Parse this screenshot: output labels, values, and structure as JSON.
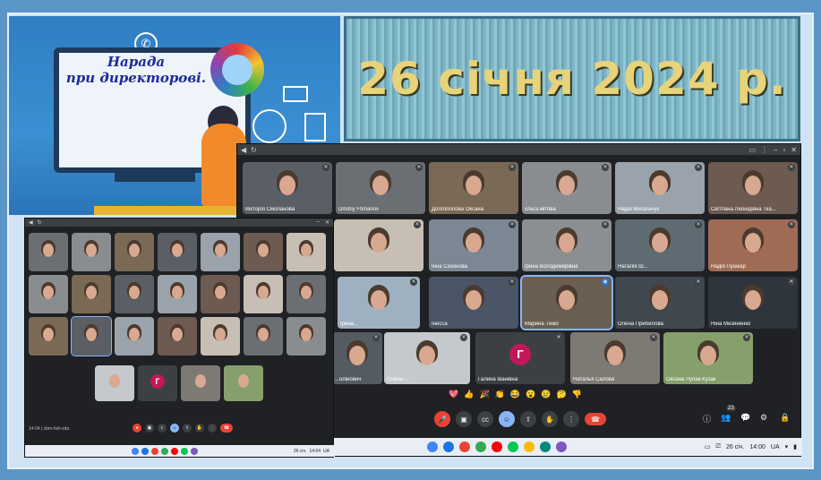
{
  "poster": {
    "title_line1": "Нарада",
    "title_line2": "при директорові.",
    "icons": [
      "phone-icon",
      "globe-icon",
      "mail-icon",
      "document-icon",
      "logo-emblem"
    ]
  },
  "date_banner": "26 січня 2024 р.",
  "meet_large": {
    "participants": [
      {
        "name": "Вікторія Смоланова"
      },
      {
        "name": "Dmitriy Ftimanov"
      },
      {
        "name": "Долгополова Оксана"
      },
      {
        "name": "ольга мітова"
      },
      {
        "name": "Надія Мигальчук"
      },
      {
        "name": "Світлана Леонідівна Тка..."
      },
      {
        "name": ""
      },
      {
        "name": "Інна Сизонова"
      },
      {
        "name": "Ірина Володимирівна"
      },
      {
        "name": "Наталія Ш..."
      },
      {
        "name": "Надія Пушкар"
      },
      {
        "name": "Ірина..."
      },
      {
        "name": "Інесса"
      },
      {
        "name": "Марина Тінко"
      },
      {
        "name": "Олена Прибилова"
      },
      {
        "name": "Ніна Мезиненко"
      },
      {
        "name": "...олійович"
      },
      {
        "name": "Олена ..."
      },
      {
        "name": "Галина Іванівна"
      },
      {
        "name": "Наталья Салова"
      },
      {
        "name": "Оксана Лупак-Кузак"
      }
    ],
    "avatar_letter": "Г",
    "reactions": [
      "💖",
      "👍",
      "🎉",
      "👏",
      "😂",
      "😮",
      "😢",
      "🤔",
      "👎"
    ],
    "participant_count": "23",
    "taskbar": {
      "date": "26 січ.",
      "time": "14:00",
      "locale": "UA"
    }
  },
  "meet_small": {
    "footer_time": "14:04",
    "footer_code": "zbm-heli-zda",
    "avatar_letter": "Г",
    "taskbar": {
      "date": "26 січ.",
      "time": "14:04",
      "locale": "UA"
    }
  }
}
